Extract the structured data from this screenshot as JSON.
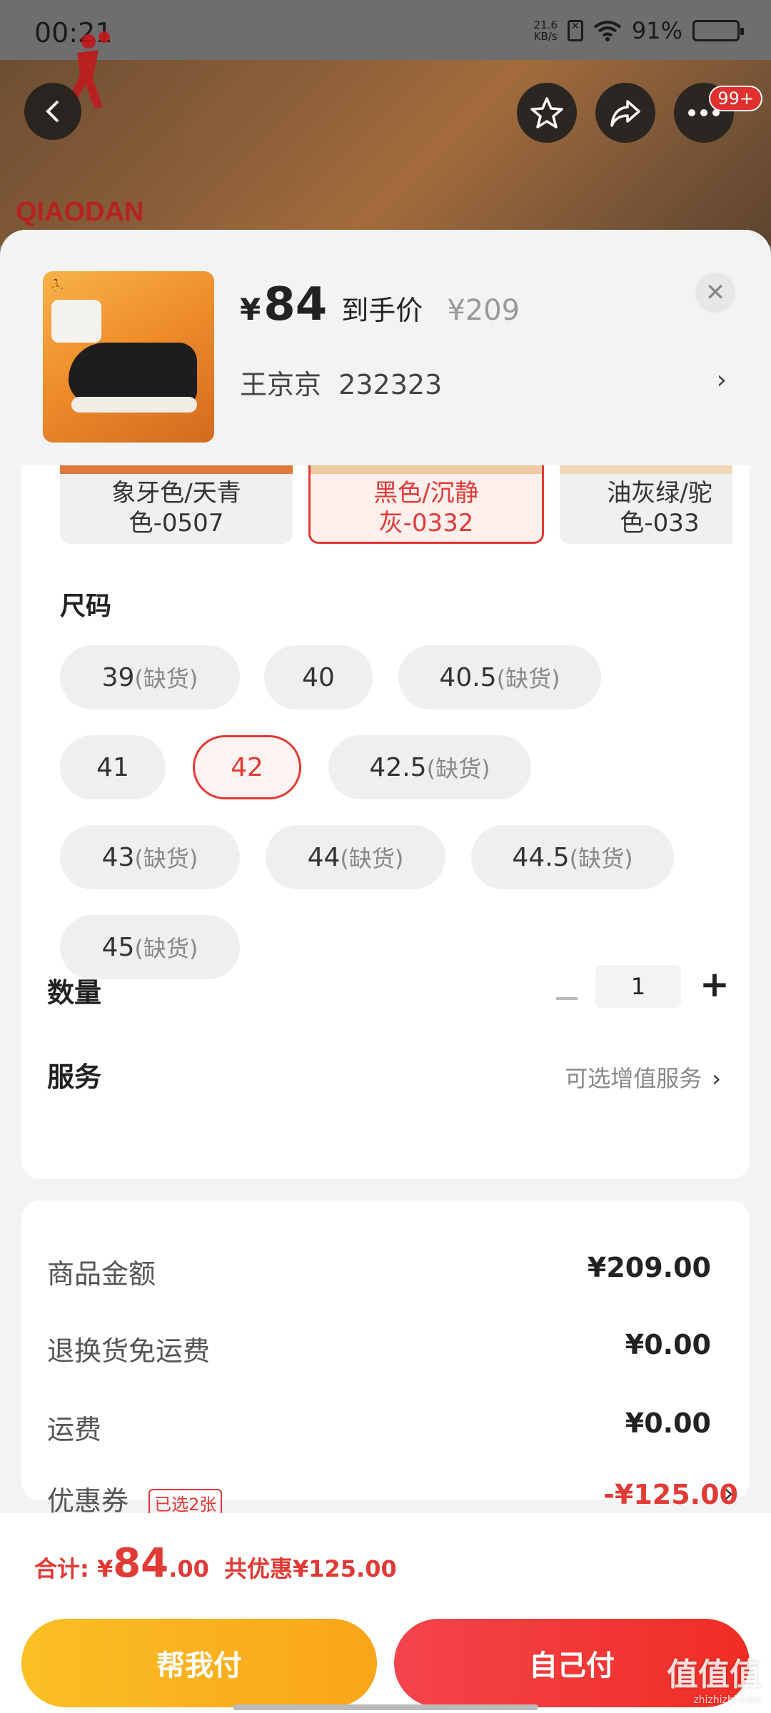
{
  "status_bar": {
    "time": "00:21",
    "net_speed": "21.6\nKB/s",
    "battery": "91%"
  },
  "hero": {
    "brand": "QIAODAN",
    "badge": "99+"
  },
  "product": {
    "currency": "¥",
    "price": "84",
    "price_tag": "到手价",
    "original_price": "¥209",
    "address": "王京京  232323"
  },
  "colors": [
    {
      "label": "象牙色/天青\n色-0507",
      "selected": false
    },
    {
      "label": "黑色/沉静\n灰-0332",
      "selected": true
    },
    {
      "label": "油灰绿/驼\n色-033",
      "selected": false
    }
  ],
  "size_section": {
    "title": "尺码"
  },
  "sizes": [
    {
      "label": "39",
      "oos": "(缺货)"
    },
    {
      "label": "40",
      "oos": ""
    },
    {
      "label": "40.5",
      "oos": "(缺货)"
    },
    {
      "label": "41",
      "oos": ""
    },
    {
      "label": "42",
      "oos": "",
      "selected": true
    },
    {
      "label": "42.5",
      "oos": "(缺货)"
    },
    {
      "label": "43",
      "oos": "(缺货)"
    },
    {
      "label": "44",
      "oos": "(缺货)"
    },
    {
      "label": "44.5",
      "oos": "(缺货)"
    },
    {
      "label": "45",
      "oos": "(缺货)"
    }
  ],
  "quantity": {
    "label": "数量",
    "value": "1",
    "minus": "−",
    "plus": "+"
  },
  "service": {
    "label": "服务",
    "hint": "可选增值服务"
  },
  "summary": {
    "goods_label": "商品金额",
    "goods_value": "¥209.00",
    "return_label": "退换货免运费",
    "return_value": "¥0.00",
    "shipping_label": "运费",
    "shipping_value": "¥0.00",
    "coupon_label": "优惠券",
    "coupon_badge": "已选2张",
    "coupon_value": "-¥125.00"
  },
  "total": {
    "label": "合计: ¥",
    "amount_big": "84",
    "amount_small": ".00",
    "discount": "共优惠¥125.00"
  },
  "buttons": {
    "help_pay": "帮我付",
    "self_pay": "自己付"
  },
  "watermark": {
    "text": "值值值",
    "sub": "zhizhizhi.com"
  },
  "colors_theme": {
    "accent": "#e23a35",
    "yellow": "#fbbf24",
    "red": "#f02d24"
  }
}
